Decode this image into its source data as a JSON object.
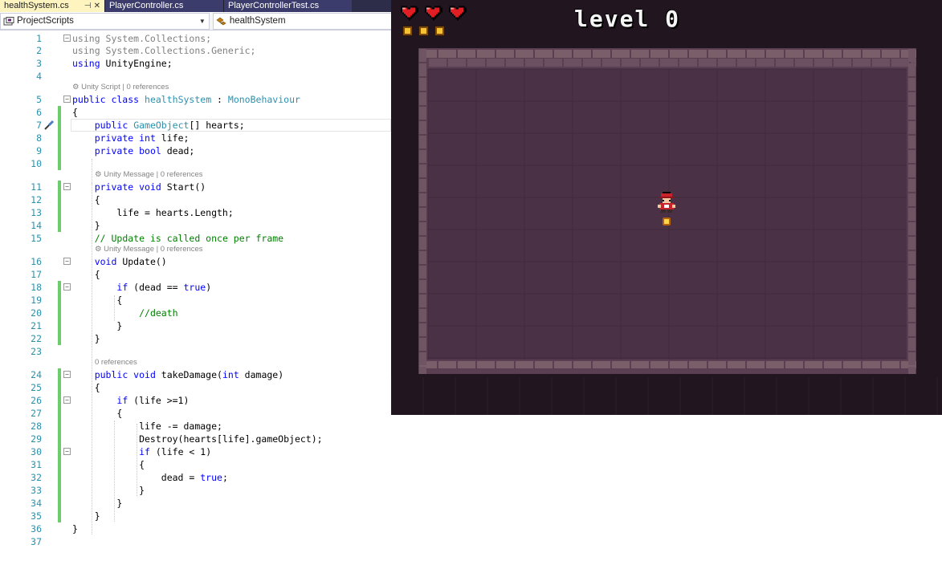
{
  "tabs": [
    {
      "label": "healthSystem.cs",
      "pin": "⊣",
      "close": "✕"
    },
    {
      "label": "PlayerController.cs"
    },
    {
      "label": "PlayerControllerTest.cs"
    }
  ],
  "nav": {
    "project": "ProjectScripts",
    "member": "healthSystem"
  },
  "code_lines": [
    {
      "n": "1",
      "html": "<span class=\"gray\">using System.Collections;</span>"
    },
    {
      "n": "2",
      "html": "<span class=\"gray\">using System.Collections.Generic;</span>"
    },
    {
      "n": "3",
      "html": "<span class=\"kw\">using</span> UnityEngine;"
    },
    {
      "n": "4",
      "html": ""
    },
    {
      "n": "5",
      "html": "<span class=\"kw\">public class</span> <span class=\"ty\">healthSystem</span> : <span class=\"ty\">MonoBehaviour</span>"
    },
    {
      "n": "6",
      "html": "{"
    },
    {
      "n": "7",
      "html": "    <span class=\"kw\">public</span> <span class=\"ty\">GameObject</span>[] hearts;"
    },
    {
      "n": "8",
      "html": "    <span class=\"kw\">private int</span> life;"
    },
    {
      "n": "9",
      "html": "    <span class=\"kw\">private bool</span> dead;"
    },
    {
      "n": "10",
      "html": ""
    },
    {
      "n": "11",
      "html": "    <span class=\"kw\">private void</span> Start()"
    },
    {
      "n": "12",
      "html": "    {"
    },
    {
      "n": "13",
      "html": "        life = hearts.Length;"
    },
    {
      "n": "14",
      "html": "    }"
    },
    {
      "n": "15",
      "html": "    <span class=\"cm\">// Update is called once per frame</span>"
    },
    {
      "n": "16",
      "html": "    <span class=\"kw\">void</span> Update()"
    },
    {
      "n": "17",
      "html": "    {"
    },
    {
      "n": "18",
      "html": "        <span class=\"kw\">if</span> (dead == <span class=\"kw\">true</span>)"
    },
    {
      "n": "19",
      "html": "        {"
    },
    {
      "n": "20",
      "html": "            <span class=\"cm\">//death</span>"
    },
    {
      "n": "21",
      "html": "        }"
    },
    {
      "n": "22",
      "html": "    }"
    },
    {
      "n": "23",
      "html": ""
    },
    {
      "n": "24",
      "html": "    <span class=\"kw\">public void</span> takeDamage(<span class=\"kw\">int</span> damage)"
    },
    {
      "n": "25",
      "html": "    {"
    },
    {
      "n": "26",
      "html": "        <span class=\"kw\">if</span> (life &gt;=1)"
    },
    {
      "n": "27",
      "html": "        {"
    },
    {
      "n": "28",
      "html": "            life -= damage;"
    },
    {
      "n": "29",
      "html": "            Destroy(hearts[life].gameObject);"
    },
    {
      "n": "30",
      "html": "            <span class=\"kw\">if</span> (life &lt; 1)"
    },
    {
      "n": "31",
      "html": "            {"
    },
    {
      "n": "32",
      "html": "                dead = <span class=\"kw\">true</span>;"
    },
    {
      "n": "33",
      "html": "            }"
    },
    {
      "n": "34",
      "html": "        }"
    },
    {
      "n": "35",
      "html": "    }"
    },
    {
      "n": "36",
      "html": "}"
    },
    {
      "n": "37",
      "html": ""
    }
  ],
  "codelens": {
    "unity_script": "⚙ Unity Script | 0 references",
    "unity_message_start": "⚙ Unity Message | 0 references",
    "unity_message_update": "⚙ Unity Message | 0 references",
    "take_damage": "0 references"
  },
  "game": {
    "title": "level 0",
    "hearts": 3,
    "coins": 3,
    "colors": {
      "background": "#211620",
      "floor": "#4a3145",
      "wall": "#7a5f6a",
      "heart": "#e01e24",
      "coin": "#f8c236"
    }
  }
}
